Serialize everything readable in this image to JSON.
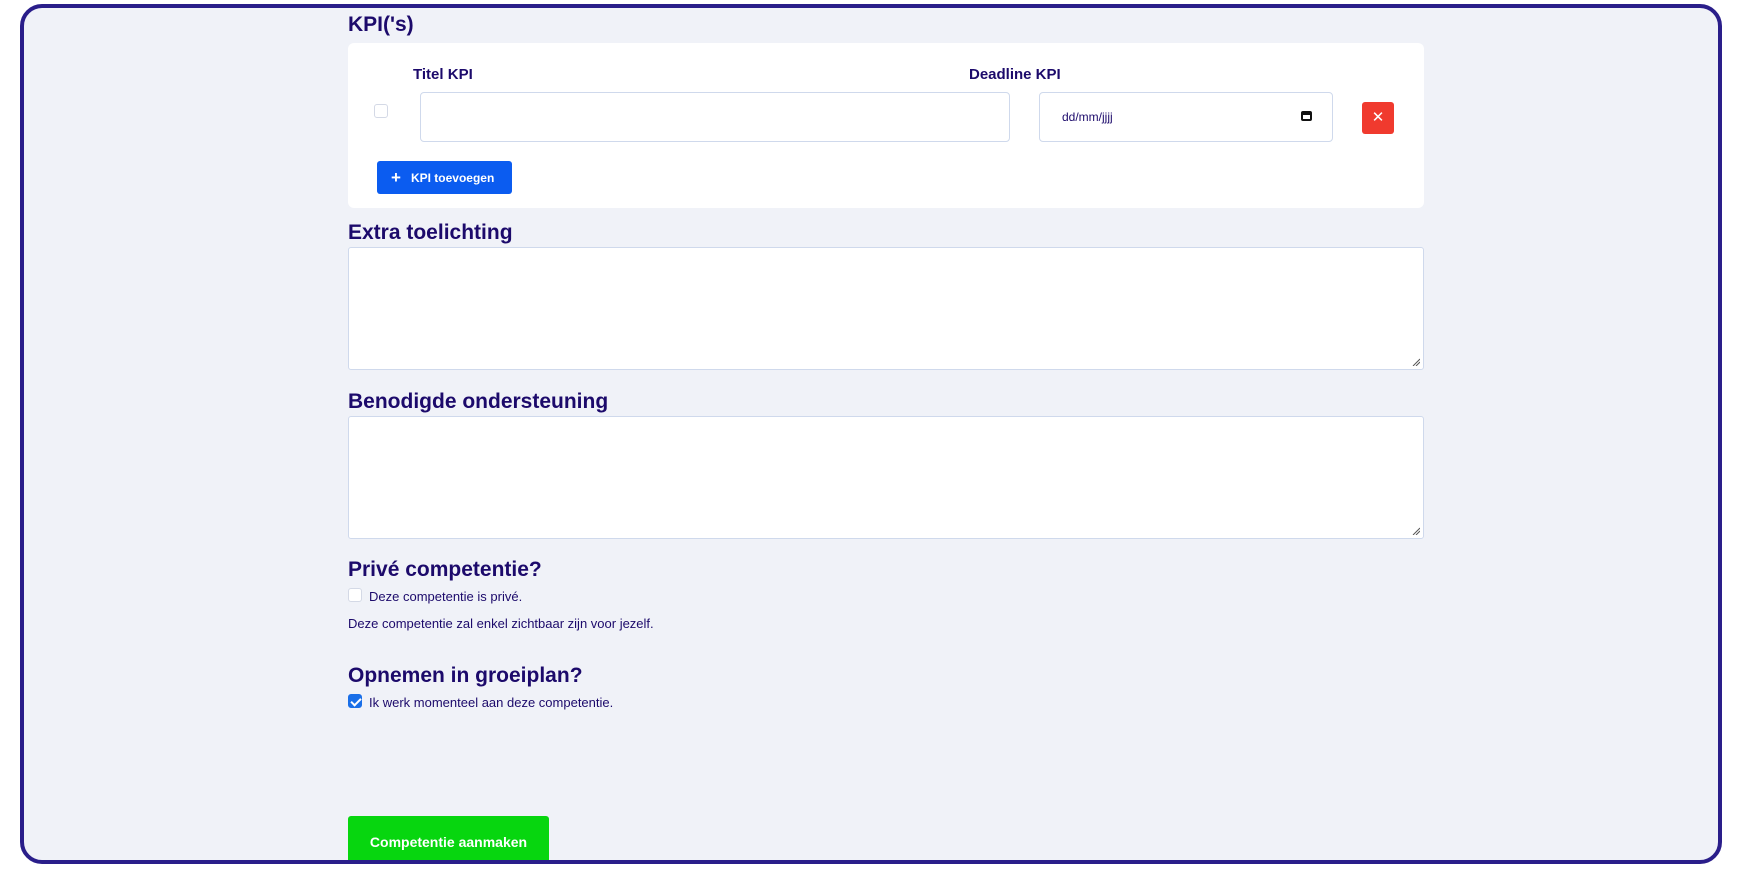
{
  "kpi": {
    "heading": "KPI('s)",
    "title_label": "Titel KPI",
    "deadline_label": "Deadline KPI",
    "title_value": "",
    "date_placeholder": "dd/mm/jjjj",
    "delete_label": "✕",
    "add_label": "KPI toevoegen",
    "add_icon": "+"
  },
  "extra": {
    "heading": "Extra toelichting",
    "value": ""
  },
  "support": {
    "heading": "Benodigde ondersteuning",
    "value": ""
  },
  "private": {
    "heading": "Privé competentie?",
    "checkbox_label": "Deze competentie is privé.",
    "checked": false,
    "help_text": "Deze competentie zal enkel zichtbaar zijn voor jezelf."
  },
  "growth": {
    "heading": "Opnemen in groeiplan?",
    "checkbox_label": "Ik werk momenteel aan deze competentie.",
    "checked": true
  },
  "submit_label": "Competentie aanmaken",
  "colors": {
    "frame_border": "#2a1e8a",
    "background": "#f0f2f8",
    "heading_text": "#1c0a6b",
    "primary_button": "#0b5cf0",
    "danger_button": "#f03a2e",
    "submit_button": "#07d60f",
    "checkbox_checked": "#1a6fe8"
  }
}
